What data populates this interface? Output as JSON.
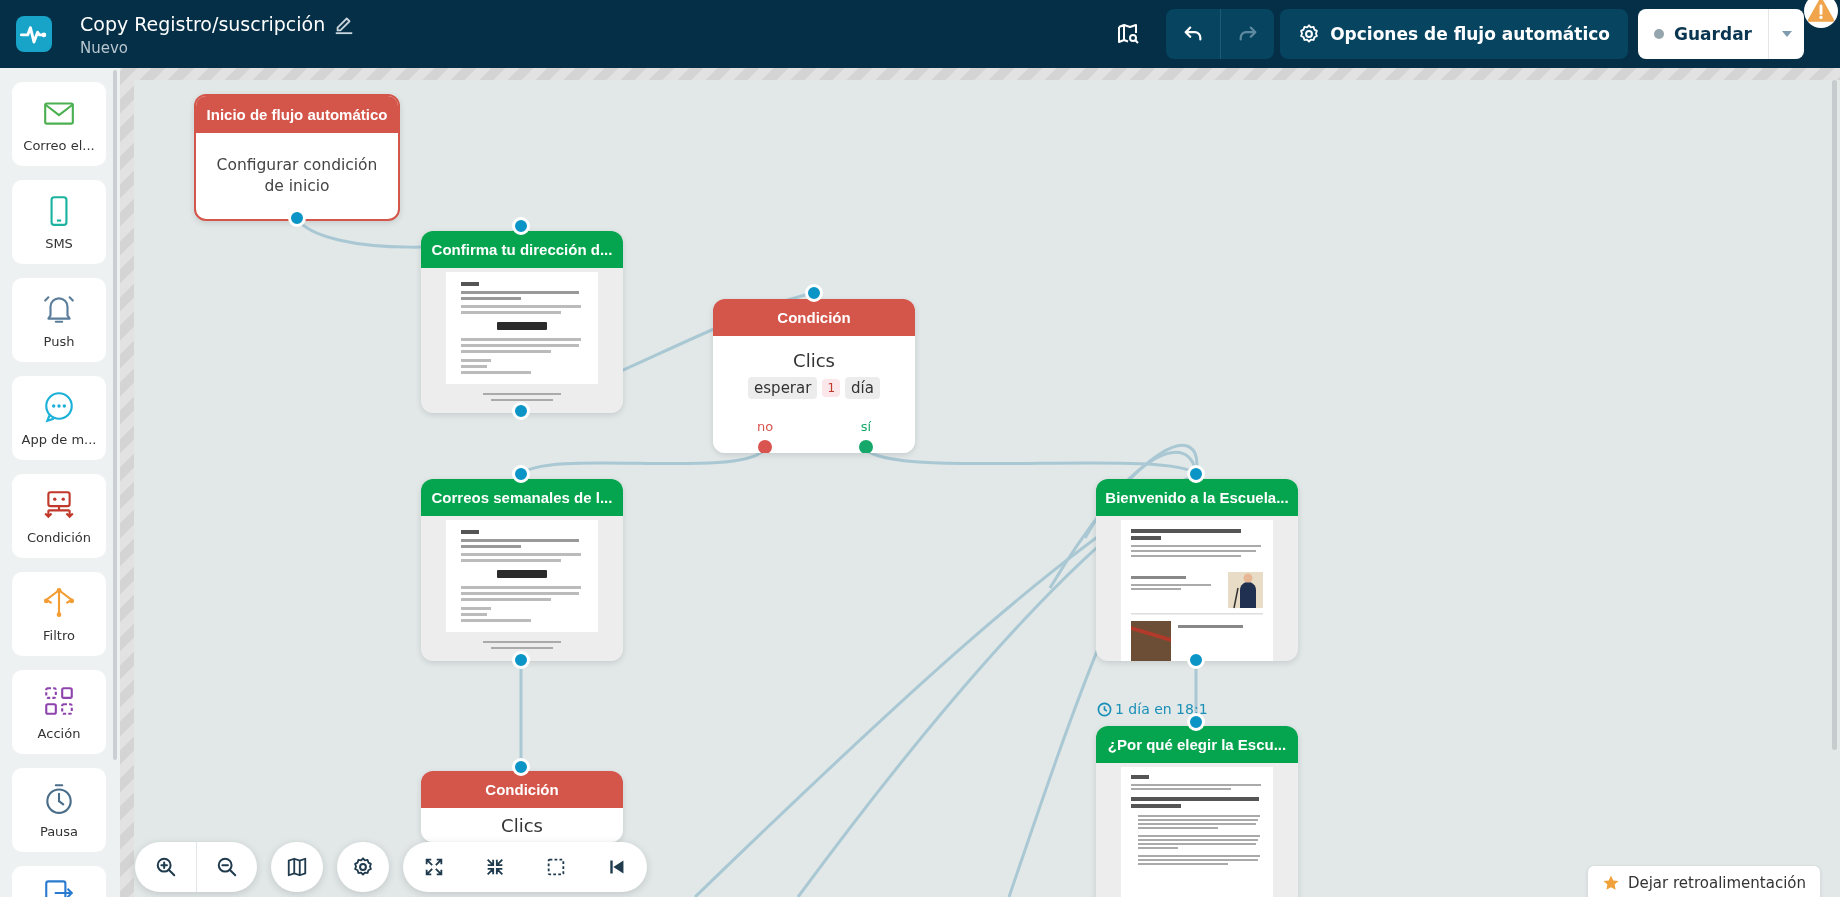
{
  "app": {
    "title": "Copy Registro/suscripción",
    "status": "Nuevo"
  },
  "history": [
    {
      "kind": "undo",
      "disabled": false
    },
    {
      "kind": "redo",
      "disabled": true
    }
  ],
  "options_button": {
    "label": "Opciones de flujo automático"
  },
  "save_button": {
    "label": "Guardar"
  },
  "sidebar": {
    "items": [
      {
        "label": "Correo el..."
      },
      {
        "label": "SMS"
      },
      {
        "label": "Push"
      },
      {
        "label": "App de m..."
      },
      {
        "label": "Condición"
      },
      {
        "label": "Filtro"
      },
      {
        "label": "Acción"
      },
      {
        "label": "Pausa"
      }
    ]
  },
  "nodes": [
    {
      "kind": "start",
      "title": "Inicio de flujo automático",
      "body": "Configurar condición de inicio"
    },
    {
      "kind": "email",
      "title": "Confirma tu dirección d..."
    },
    {
      "kind": "condition",
      "title": "Condición",
      "rule": "Clics",
      "wait": [
        {
          "kind": "word",
          "text": "esperar"
        },
        {
          "kind": "value",
          "text": "1"
        },
        {
          "kind": "word",
          "text": "día"
        }
      ],
      "outputs": [
        {
          "label": "no",
          "color": "#d9534f"
        },
        {
          "label": "sí",
          "color": "#16a86a"
        }
      ]
    },
    {
      "kind": "email",
      "title": "Correos semanales de l..."
    },
    {
      "kind": "condition",
      "title": "Condición",
      "rule": "Clics"
    },
    {
      "kind": "email",
      "title": "Bienvenido a la Escuela..."
    },
    {
      "kind": "email",
      "title": "¿Por qué elegir la Escu..."
    }
  ],
  "timer": {
    "label": "1 día en 18:1"
  },
  "feedback_button": {
    "label": "Dejar retroalimentación"
  }
}
